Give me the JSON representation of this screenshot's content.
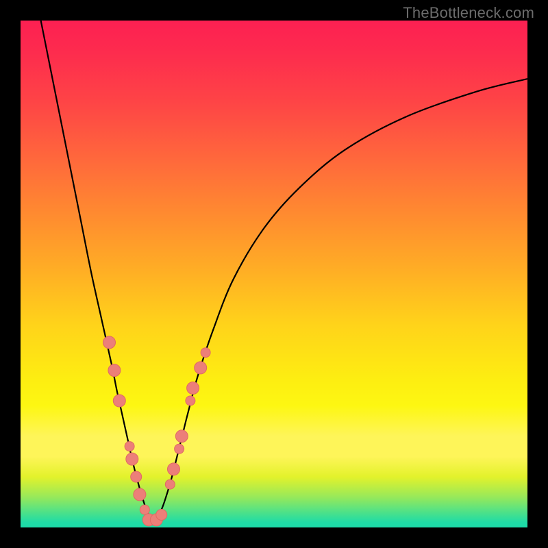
{
  "watermark": "TheBottleneck.com",
  "colors": {
    "background": "#000000",
    "curve_stroke": "#000000",
    "marker_fill": "#ec7f79",
    "marker_stroke": "#e06a63"
  },
  "chart_data": {
    "type": "line",
    "title": "",
    "xlabel": "",
    "ylabel": "",
    "xlim": [
      0,
      100
    ],
    "ylim": [
      0,
      100
    ],
    "grid": false,
    "legend": false,
    "annotations": [],
    "series": [
      {
        "name": "left-branch",
        "x": [
          4,
          6,
          8,
          10,
          12,
          14,
          16,
          18,
          19,
          20,
          21,
          22,
          23,
          24,
          25,
          26
        ],
        "y": [
          100,
          90,
          80,
          70,
          60,
          50,
          41,
          32,
          27,
          22.5,
          18,
          13.5,
          9.5,
          6,
          3,
          1
        ]
      },
      {
        "name": "right-branch",
        "x": [
          26,
          27,
          28,
          29,
          30,
          31,
          32,
          33,
          35,
          38,
          42,
          48,
          55,
          64,
          76,
          90,
          100
        ],
        "y": [
          1,
          2,
          4,
          7,
          10.5,
          14.5,
          18.5,
          22.5,
          30,
          39,
          49,
          59,
          67,
          74.5,
          81,
          86,
          88.5
        ]
      }
    ],
    "markers": [
      {
        "x": 17.5,
        "y": 36.5,
        "r": 9
      },
      {
        "x": 18.5,
        "y": 31.0,
        "r": 9
      },
      {
        "x": 19.5,
        "y": 25.0,
        "r": 9
      },
      {
        "x": 21.5,
        "y": 16.0,
        "r": 7
      },
      {
        "x": 22.0,
        "y": 13.5,
        "r": 9
      },
      {
        "x": 22.8,
        "y": 10.0,
        "r": 8
      },
      {
        "x": 23.5,
        "y": 6.5,
        "r": 9
      },
      {
        "x": 24.5,
        "y": 3.5,
        "r": 7
      },
      {
        "x": 25.3,
        "y": 1.5,
        "r": 9
      },
      {
        "x": 26.8,
        "y": 1.5,
        "r": 9
      },
      {
        "x": 27.8,
        "y": 2.5,
        "r": 8
      },
      {
        "x": 29.5,
        "y": 8.5,
        "r": 7
      },
      {
        "x": 30.2,
        "y": 11.5,
        "r": 9
      },
      {
        "x": 31.3,
        "y": 15.5,
        "r": 7
      },
      {
        "x": 31.8,
        "y": 18.0,
        "r": 9
      },
      {
        "x": 33.5,
        "y": 25.0,
        "r": 7
      },
      {
        "x": 34.0,
        "y": 27.5,
        "r": 9
      },
      {
        "x": 35.5,
        "y": 31.5,
        "r": 9
      },
      {
        "x": 36.5,
        "y": 34.5,
        "r": 7
      }
    ]
  }
}
